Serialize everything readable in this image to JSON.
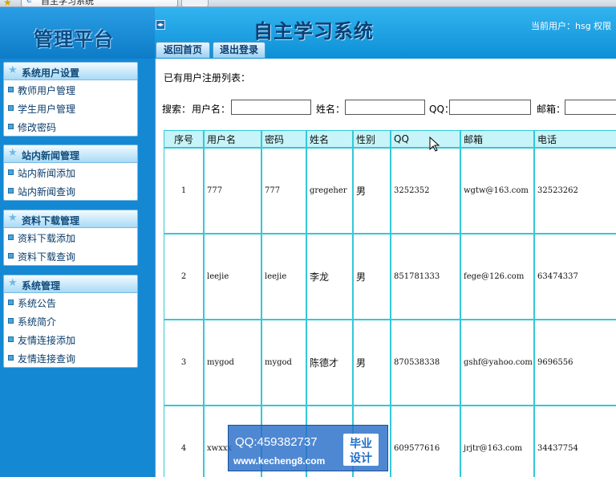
{
  "browser": {
    "tab_title": "自主学习系统"
  },
  "header": {
    "platform_title": "管理平台",
    "system_title": "自主学习系统",
    "user_info": "当前用户：hsg 权限",
    "nav": {
      "home": "返回首页",
      "logout": "退出登录"
    }
  },
  "sidebar": {
    "panels": [
      {
        "title": "系统用户设置",
        "items": [
          "教师用户管理",
          "学生用户管理",
          "修改密码"
        ]
      },
      {
        "title": "站内新闻管理",
        "items": [
          "站内新闻添加",
          "站内新闻查询"
        ]
      },
      {
        "title": "资料下载管理",
        "items": [
          "资料下载添加",
          "资料下载查询"
        ]
      },
      {
        "title": "系统管理",
        "items": [
          "系统公告",
          "系统简介",
          "友情连接添加",
          "友情连接查询"
        ]
      }
    ]
  },
  "main": {
    "list_title": "已有用户注册列表：",
    "search": {
      "label": "搜索：",
      "username_label": "用户名：",
      "name_label": "姓名：",
      "qq_label": "QQ：",
      "email_label": "邮箱："
    },
    "table": {
      "headers": [
        "序号",
        "用户名",
        "密码",
        "姓名",
        "性别",
        "QQ",
        "邮箱",
        "电话"
      ],
      "rows": [
        [
          "1",
          "777",
          "777",
          "gregeher",
          "男",
          "3252352",
          "wgtw@163.com",
          "32523262"
        ],
        [
          "2",
          "leejie",
          "leejie",
          "李龙",
          "男",
          "851781333",
          "fege@126.com",
          "63474337"
        ],
        [
          "3",
          "mygod",
          "mygod",
          "陈德才",
          "男",
          "870538338",
          "gshf@yahoo.com",
          "9696556"
        ],
        [
          "4",
          "xwxxx",
          "",
          "",
          "",
          "609577616",
          "jrjtr@163.com",
          "34437754"
        ]
      ]
    }
  },
  "watermark": {
    "qq": "QQ:459382737",
    "url": "www.kecheng8.com",
    "badge_top": "毕业",
    "badge_bottom": "设计"
  }
}
